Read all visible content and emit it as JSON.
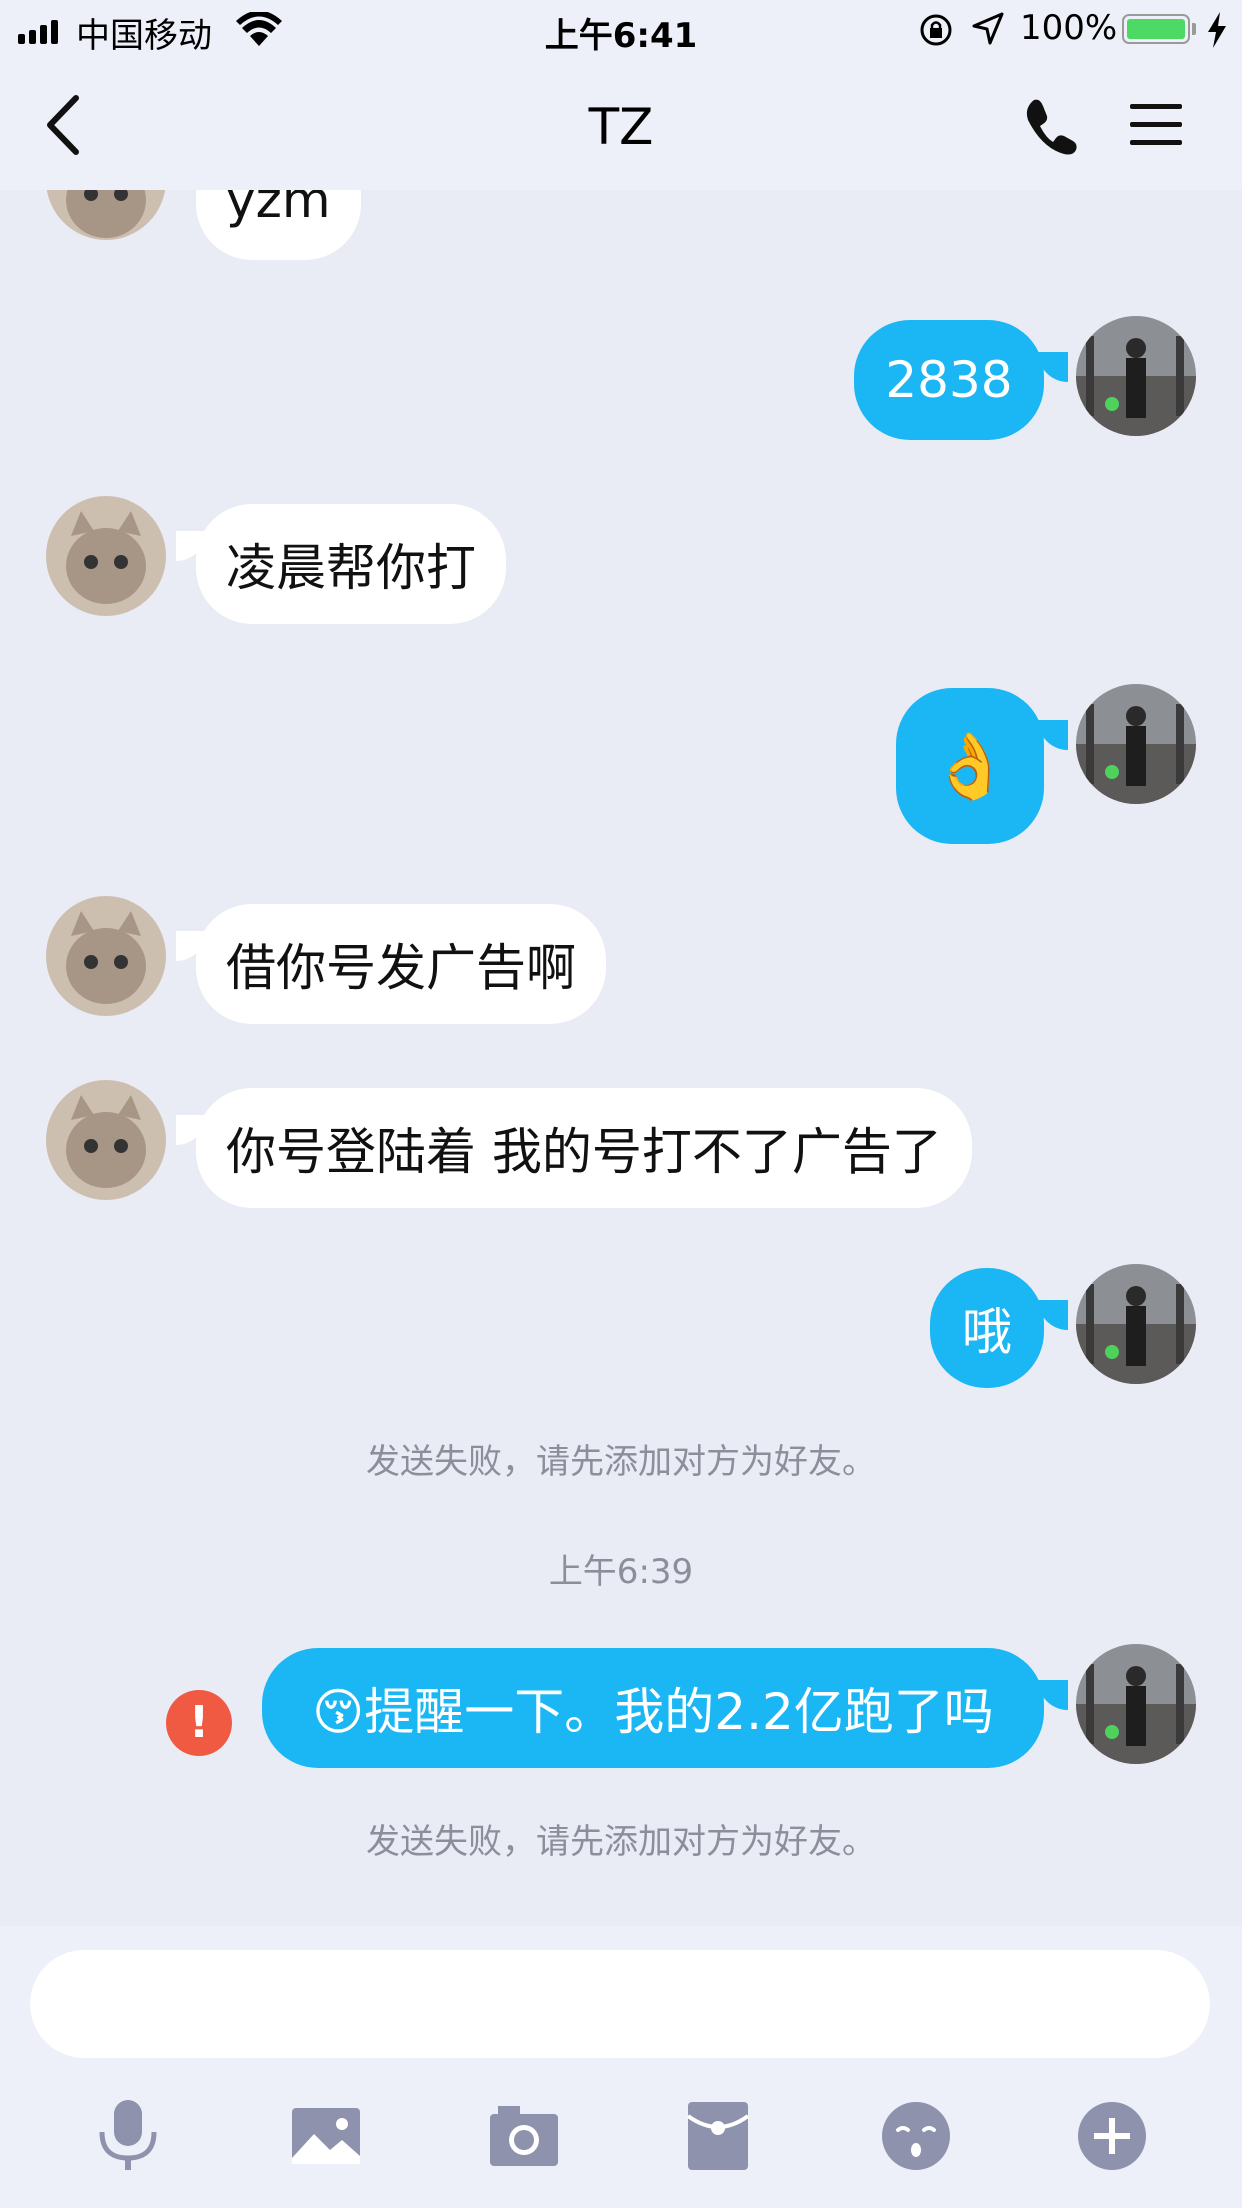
{
  "status_bar": {
    "carrier": "中国移动",
    "time": "上午6:41",
    "battery_percent": "100%",
    "battery_level": 1.0,
    "battery_color": "#4cd964"
  },
  "nav": {
    "title": "TZ",
    "back_icon": "chevron-left-icon",
    "call_icon": "phone-icon",
    "menu_icon": "hamburger-menu-icon"
  },
  "messages": [
    {
      "side": "left",
      "text": "yzm"
    },
    {
      "side": "right",
      "text": "2838"
    },
    {
      "side": "left",
      "text": "凌晨帮你打"
    },
    {
      "side": "right",
      "text": "👌"
    },
    {
      "side": "left",
      "text": "借你号发广告啊"
    },
    {
      "side": "left",
      "text": "你号登陆着 我的号打不了广告了"
    },
    {
      "side": "right",
      "text": "哦"
    },
    {
      "side": "system",
      "text": "发送失败，请先添加对方为好友。"
    },
    {
      "side": "timestamp",
      "text": "上午6:39"
    },
    {
      "side": "right",
      "text": "😚提醒一下。我的2.2亿跑了吗",
      "failed": true
    },
    {
      "side": "system",
      "text": "发送失败，请先添加对方为好友。"
    }
  ],
  "colors": {
    "background": "#e9ebf5",
    "outgoing_bubble": "#1bb6f4",
    "incoming_bubble": "#ffffff",
    "error": "#f05a43",
    "icon_gray": "#8e92ad"
  },
  "input": {
    "placeholder": "",
    "value": ""
  },
  "toolbar": [
    "microphone-icon",
    "image-icon",
    "camera-icon",
    "red-packet-icon",
    "emoji-icon",
    "plus-icon"
  ]
}
